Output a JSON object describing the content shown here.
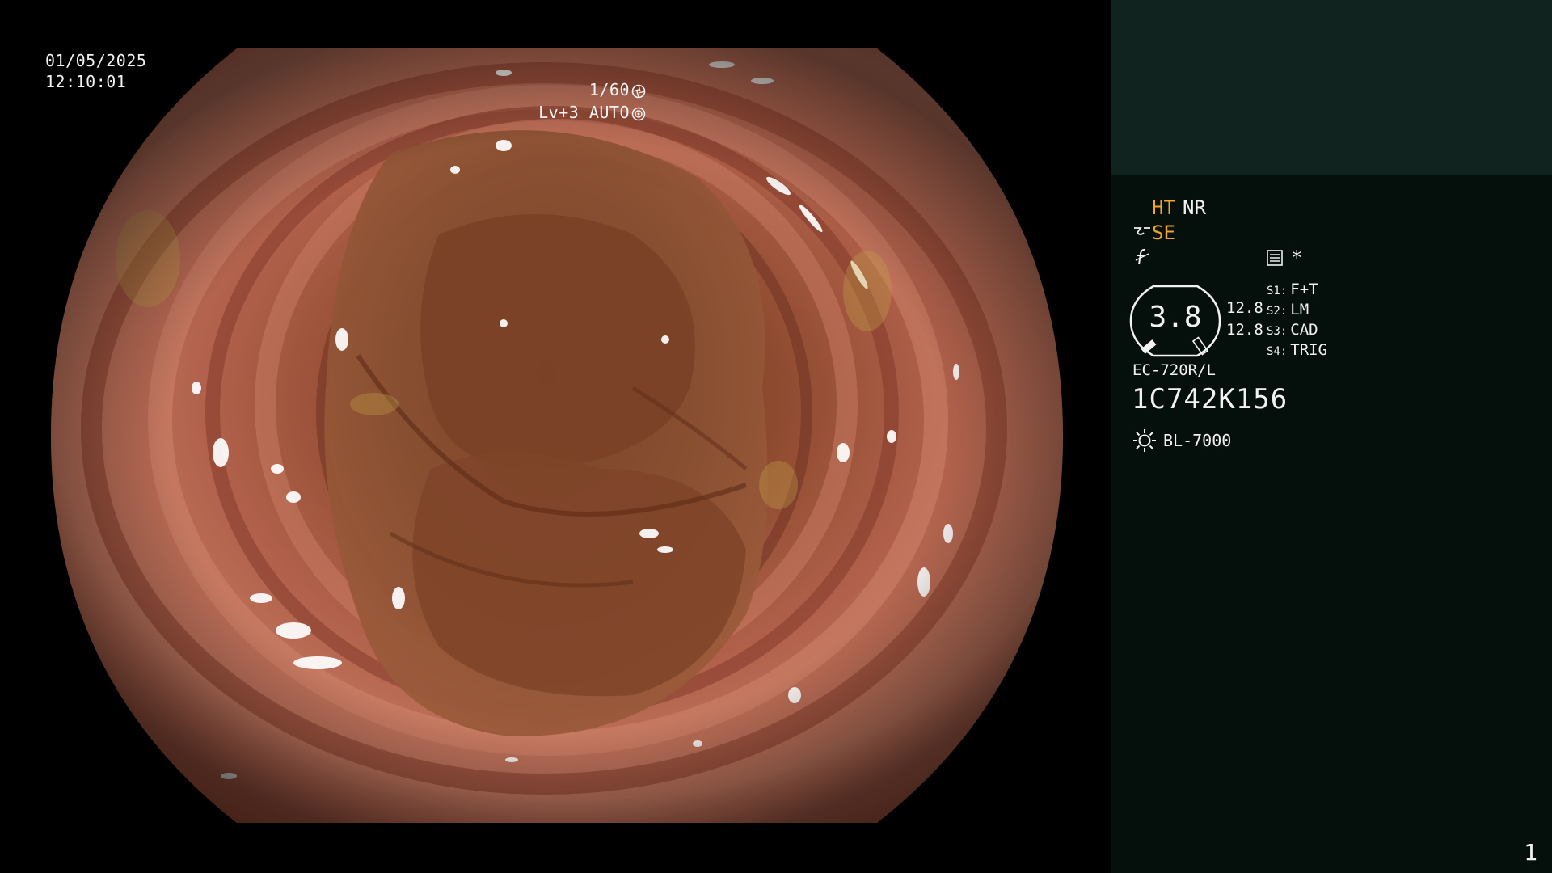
{
  "image_overlay": {
    "date": "01/05/2025",
    "time": "12:10:01",
    "shutter": "1/60",
    "shutter_icon": "aperture-icon",
    "level": "Lv+3 AUTO",
    "level_icon": "auto-iris-icon"
  },
  "panel": {
    "ht_label": "HT",
    "nr_label": "NR",
    "se_label": "SE",
    "se_icon": "enhancement-icon",
    "ftilde_icon": "f-slash-icon",
    "memo_icon": "memo-icon",
    "asterisk": "*",
    "gauge": {
      "value": "3.8",
      "value_1": "12.8",
      "value_2": "12.8"
    },
    "switches": [
      {
        "key": "S1:",
        "value": "F+T"
      },
      {
        "key": "S2:",
        "value": "LM"
      },
      {
        "key": "S3:",
        "value": "CAD"
      },
      {
        "key": "S4:",
        "value": "TRIG"
      }
    ],
    "scope_model": "EC-720R/L",
    "scope_serial": "1C742K156",
    "light_icon": "sun-icon",
    "light_source": "BL-7000",
    "page_number": "1"
  },
  "colors": {
    "panel_bg": "#050f0c",
    "panel_header_bg": "#10231f",
    "accent_amber": "#f5a623",
    "text": "#f2f2f2",
    "tissue": "#b0604a"
  }
}
